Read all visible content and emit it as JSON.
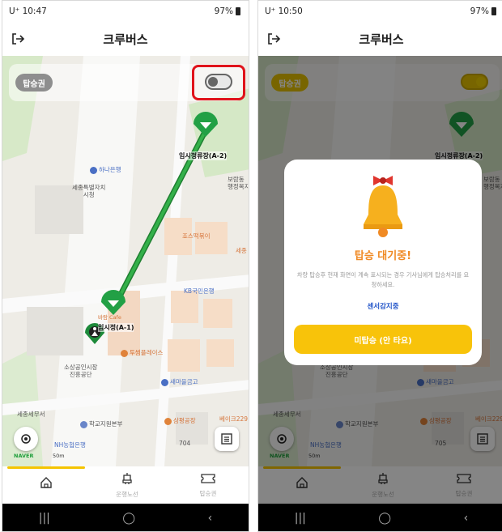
{
  "colors": {
    "accent": "#f5c400",
    "route": "#2a9a3c",
    "highlight": "#e0131b",
    "dialog_title": "#f08a24",
    "sensor_link": "#2456c9"
  },
  "left": {
    "status": {
      "carrier_time": "U⁺ 10:47",
      "battery": "97%"
    },
    "app_title": "크루버스",
    "boarding_chip": "탑승권",
    "map": {
      "stop_a2": "임시정류장(A-2)",
      "stop_a1": "임시정(A-1)",
      "pois": [
        "하나은행",
        "세종특별자치\n시청",
        "보람동\n행정복지센",
        "죠스떡볶이",
        "세종",
        "KB국민은행",
        "바람 Cafe",
        "투썸플레이스",
        "소상공인시장\n진흥공단",
        "새마을금고",
        "세종세무서",
        "학교지원본부",
        "삼평공장",
        "베이크229",
        "NH농협은행"
      ],
      "naver": "NAVER",
      "scale": "50m",
      "road_num": "704"
    },
    "nav": [
      {
        "label": "",
        "icon": "home-icon",
        "active": true
      },
      {
        "label": "운행노선",
        "icon": "bus-stop-icon",
        "active": false
      },
      {
        "label": "탑승권",
        "icon": "ticket-icon",
        "active": false
      }
    ]
  },
  "right": {
    "status": {
      "carrier_time": "U⁺ 10:50",
      "battery": "97%"
    },
    "app_title": "크루버스",
    "boarding_chip": "탑승권",
    "map": {
      "stop_a2": "임시정류장(A-2)",
      "pois": [
        "보람동\n행정복지센",
        "소상공인시장\n진흥공단",
        "새마을금고",
        "세종세무서",
        "학교지원본부",
        "삼평공장",
        "베이크229",
        "NH농협은행"
      ],
      "naver": "NAVER",
      "scale": "50m",
      "road_num": "705"
    },
    "dialog": {
      "title": "탑승 대기중!",
      "message": "차량 탑승후 현재 화면이 계속 표시되는 경우 기사님에게 탑승처리를 요청하세요.",
      "sensor": "센서감지중",
      "button": "미탑승 (안 타요)"
    },
    "nav": [
      {
        "label": "",
        "icon": "home-icon",
        "active": true
      },
      {
        "label": "운행노선",
        "icon": "bus-stop-icon",
        "active": false
      },
      {
        "label": "탑승권",
        "icon": "ticket-icon",
        "active": false
      }
    ]
  }
}
